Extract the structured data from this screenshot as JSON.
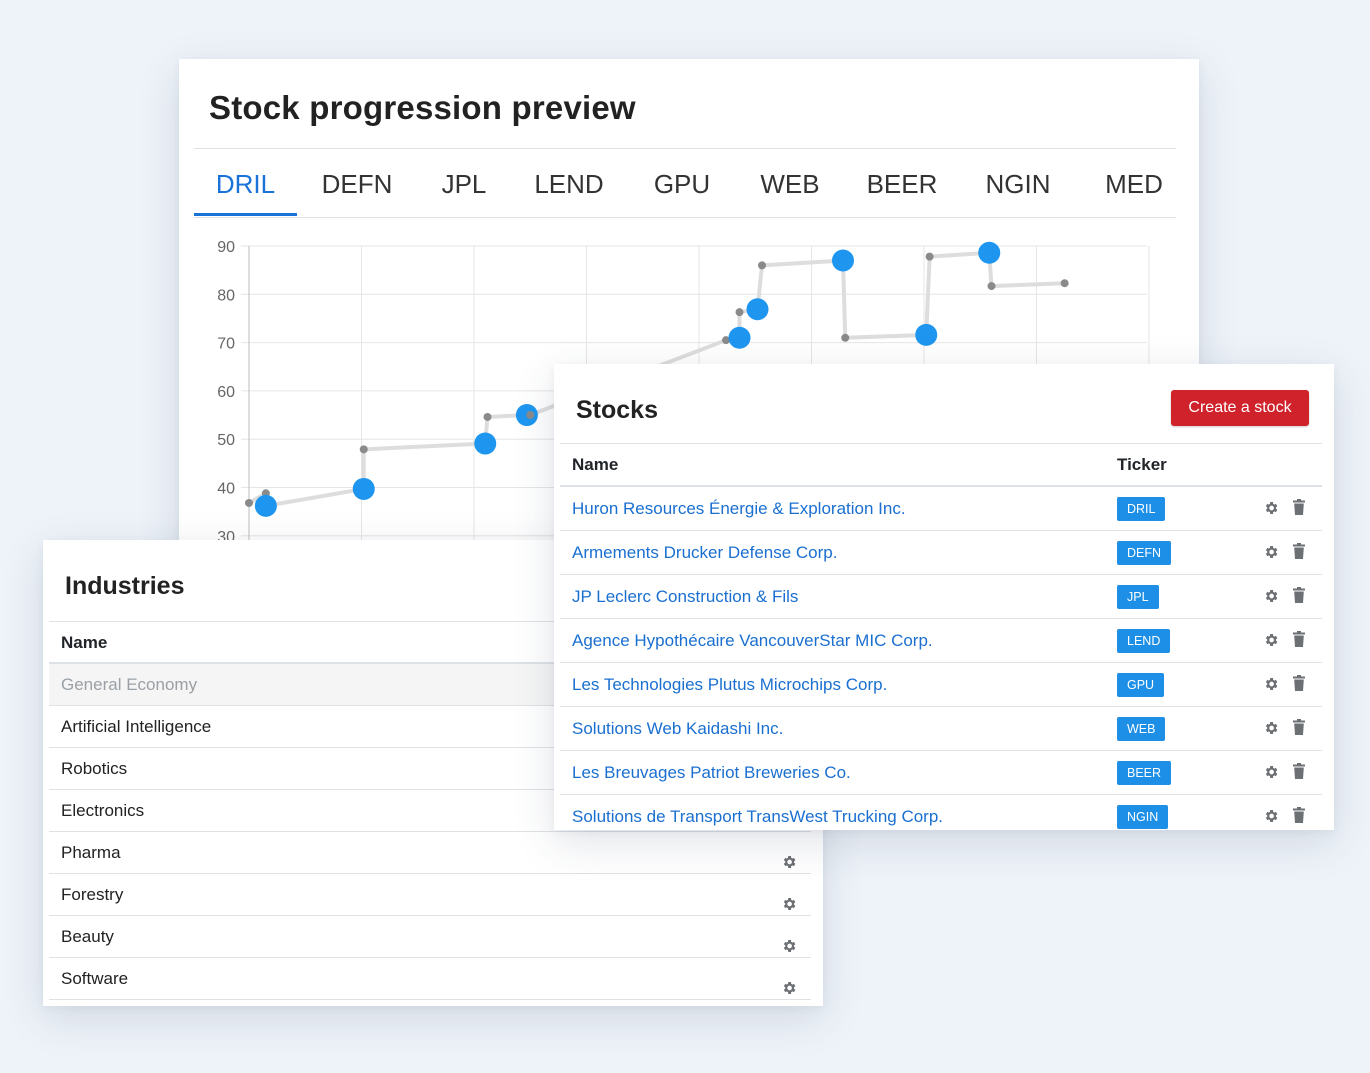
{
  "chart_card": {
    "title": "Stock progression preview",
    "tabs": [
      "DRIL",
      "DEFN",
      "JPL",
      "LEND",
      "GPU",
      "WEB",
      "BEER",
      "NGIN",
      "MED"
    ],
    "active_tab": "DRIL"
  },
  "chart_data": {
    "type": "line",
    "ylim": [
      30,
      90
    ],
    "ytick_labels": [
      "30",
      "40",
      "50",
      "60",
      "70",
      "80",
      "90"
    ],
    "grid": true,
    "points": [
      {
        "x": 0.0,
        "y": 36.8,
        "marker": "small"
      },
      {
        "x": 0.15,
        "y": 38.8,
        "marker": "small"
      },
      {
        "x": 0.15,
        "y": 36.2,
        "marker": "large"
      },
      {
        "x": 1.02,
        "y": 39.7,
        "marker": "large"
      },
      {
        "x": 1.02,
        "y": 47.9,
        "marker": "small"
      },
      {
        "x": 2.1,
        "y": 49.1,
        "marker": "large"
      },
      {
        "x": 2.12,
        "y": 54.6,
        "marker": "small"
      },
      {
        "x": 2.47,
        "y": 55.0,
        "marker": "large"
      },
      {
        "x": 2.5,
        "y": 55.0,
        "marker": "small"
      },
      {
        "x": 4.24,
        "y": 70.5,
        "marker": "small"
      },
      {
        "x": 4.36,
        "y": 71.0,
        "marker": "large"
      },
      {
        "x": 4.36,
        "y": 76.3,
        "marker": "small"
      },
      {
        "x": 4.52,
        "y": 76.9,
        "marker": "large"
      },
      {
        "x": 4.56,
        "y": 86.0,
        "marker": "small"
      },
      {
        "x": 5.28,
        "y": 87.0,
        "marker": "large"
      },
      {
        "x": 5.3,
        "y": 71.0,
        "marker": "small"
      },
      {
        "x": 6.02,
        "y": 71.6,
        "marker": "large"
      },
      {
        "x": 6.05,
        "y": 87.8,
        "marker": "small"
      },
      {
        "x": 6.58,
        "y": 88.6,
        "marker": "large"
      },
      {
        "x": 6.6,
        "y": 81.7,
        "marker": "small"
      },
      {
        "x": 7.25,
        "y": 82.3,
        "marker": "small"
      }
    ]
  },
  "industries": {
    "title": "Industries",
    "column_name": "Name",
    "rows": [
      {
        "name": "General Economy",
        "disabled": true
      },
      {
        "name": "Artificial Intelligence",
        "disabled": false
      },
      {
        "name": "Robotics",
        "disabled": false
      },
      {
        "name": "Electronics",
        "disabled": false
      },
      {
        "name": "Pharma",
        "disabled": false
      },
      {
        "name": "Forestry",
        "disabled": false
      },
      {
        "name": "Beauty",
        "disabled": false
      },
      {
        "name": "Software",
        "disabled": false
      }
    ]
  },
  "stocks": {
    "title": "Stocks",
    "create_label": "Create a stock",
    "column_name": "Name",
    "column_ticker": "Ticker",
    "rows": [
      {
        "name": "Huron Resources Énergie & Exploration Inc.",
        "ticker": "DRIL"
      },
      {
        "name": "Armements Drucker Defense Corp.",
        "ticker": "DEFN"
      },
      {
        "name": "JP Leclerc Construction & Fils",
        "ticker": "JPL"
      },
      {
        "name": "Agence Hypothécaire VancouverStar MIC Corp.",
        "ticker": "LEND"
      },
      {
        "name": "Les Technologies Plutus Microchips Corp.",
        "ticker": "GPU"
      },
      {
        "name": "Solutions Web Kaidashi Inc.",
        "ticker": "WEB"
      },
      {
        "name": "Les Breuvages Patriot Breweries Co.",
        "ticker": "BEER"
      },
      {
        "name": "Solutions de Transport TransWest Trucking Corp.",
        "ticker": "NGIN"
      }
    ]
  },
  "icons": {
    "settings": "gear-icon",
    "delete": "trash-icon"
  },
  "colors": {
    "accent": "#1a73d8",
    "primary_button": "#d0222b",
    "badge": "#1e8fe6",
    "point": "#1e96f0",
    "line": "#dddddd"
  }
}
